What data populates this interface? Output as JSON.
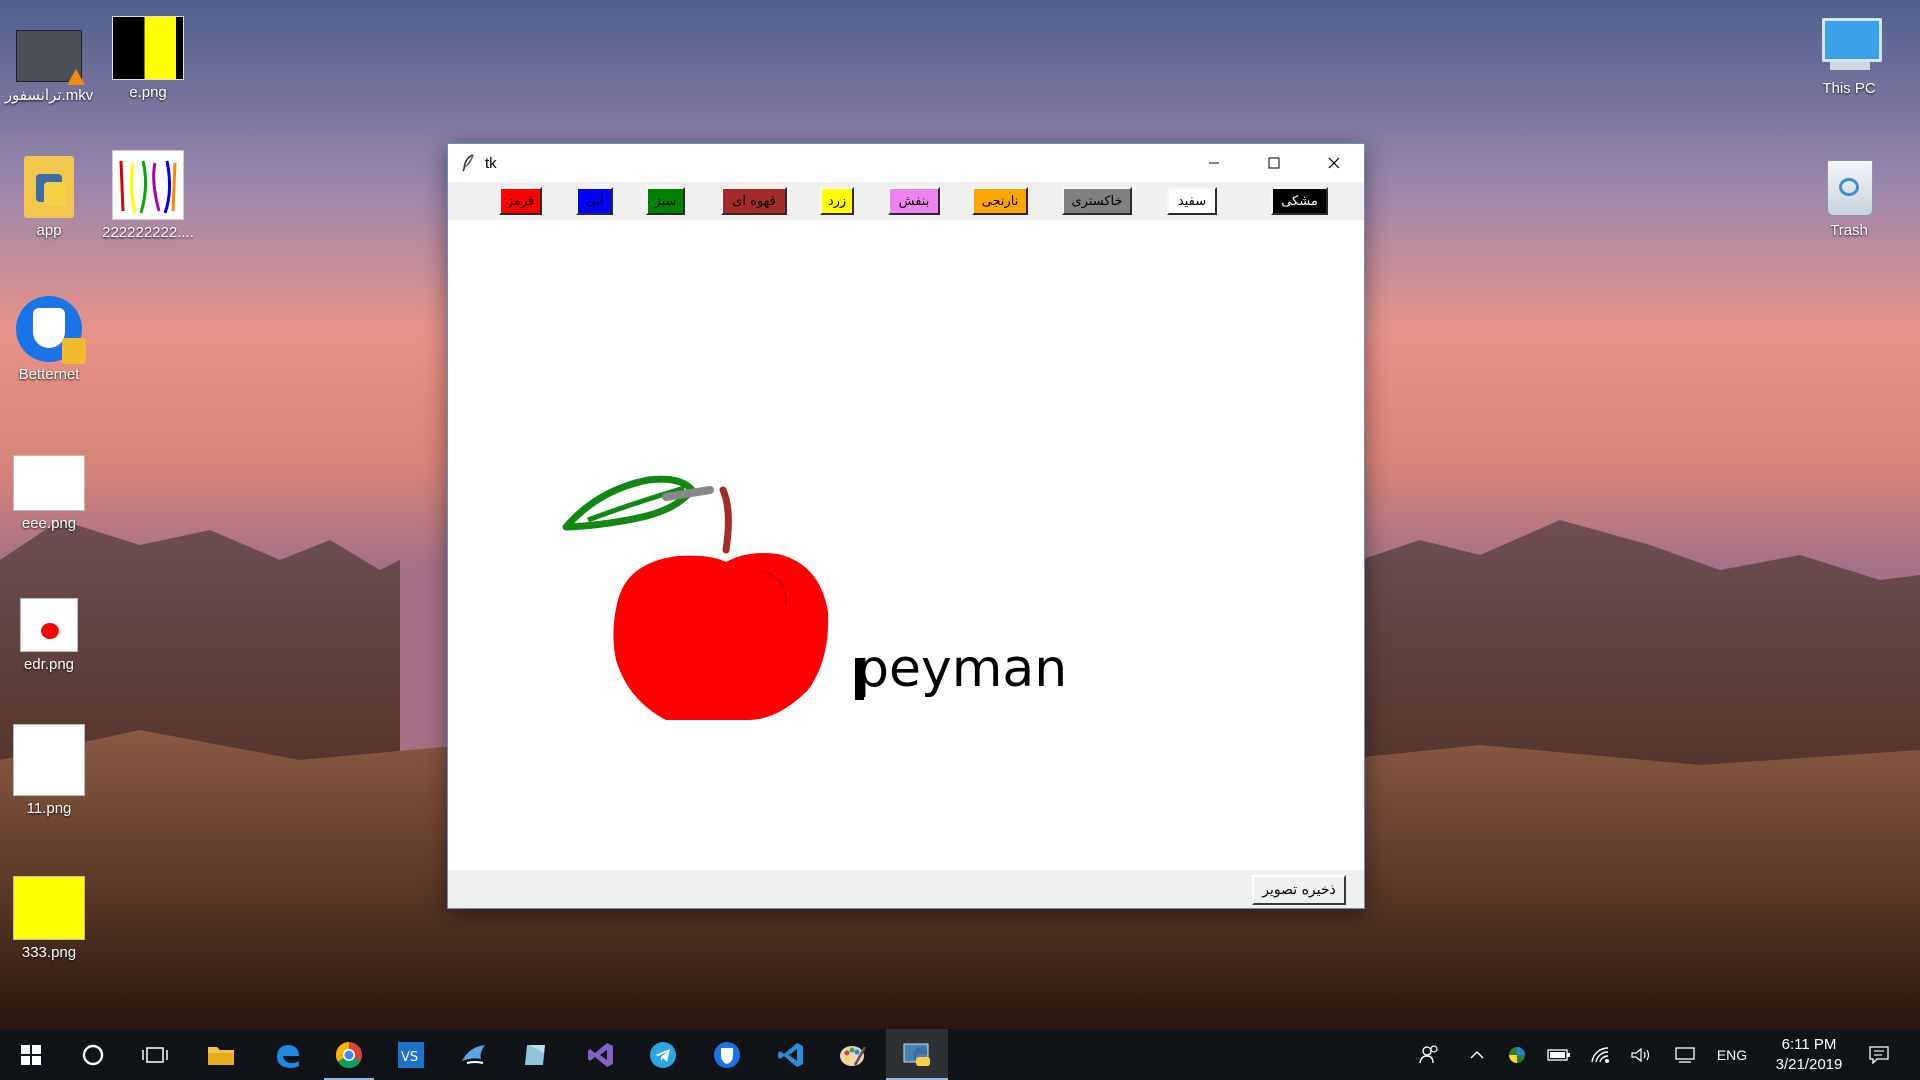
{
  "desktop": {
    "icons": [
      {
        "label": "ترانسفور.mkv"
      },
      {
        "label": "e.png"
      },
      {
        "label": "app"
      },
      {
        "label": "222222222...."
      },
      {
        "label": "Betternet"
      },
      {
        "label": "eee.png"
      },
      {
        "label": "edr.png"
      },
      {
        "label": "11.png"
      },
      {
        "label": "333.png"
      },
      {
        "label": "This PC"
      },
      {
        "label": "Trash"
      }
    ]
  },
  "window": {
    "title": "tk",
    "color_buttons": [
      {
        "label": "قرمز",
        "color": "#ff0000"
      },
      {
        "label": "آبی",
        "color": "#0000ff"
      },
      {
        "label": "سبز",
        "color": "#008000"
      },
      {
        "label": "قهوه ای",
        "color": "#a52a2a"
      },
      {
        "label": "زرد",
        "color": "#ffff00"
      },
      {
        "label": "بنفش",
        "color": "#ee82ee"
      },
      {
        "label": "نارنجی",
        "color": "#ffa500"
      },
      {
        "label": "خاکستری",
        "color": "#808080"
      },
      {
        "label": "سفید",
        "color": "#ffffff"
      },
      {
        "label": "مشکی",
        "color": "#000000"
      }
    ],
    "canvas_text": "peyman",
    "save_button": "ذخیره تصویر"
  },
  "taskbar": {
    "language": "ENG",
    "time": "6:11 PM",
    "date": "3/21/2019"
  }
}
